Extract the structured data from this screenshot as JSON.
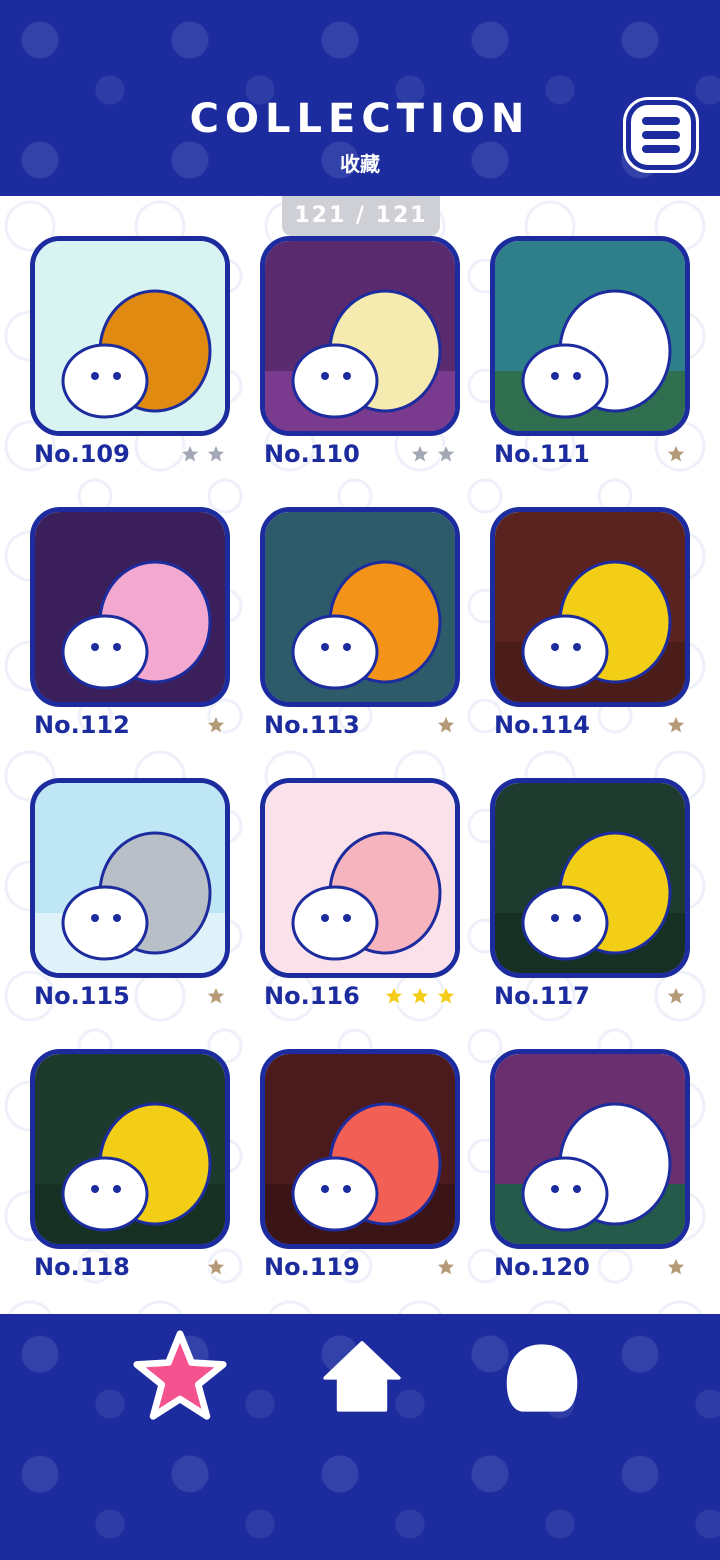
{
  "header": {
    "title": "COLLECTION",
    "subtitle": "收藏",
    "menu_icon": "menu-icon"
  },
  "counter": "121 / 121",
  "colors": {
    "navy": "#1c2c9e",
    "star_gold": "#f4cc1a",
    "star_gray": "#a3a9b4",
    "star_bronze": "#b59a77",
    "nav_star_pink": "#f4528f"
  },
  "cards": [
    {
      "number": "No.109",
      "stars": 2,
      "star_color": "gray"
    },
    {
      "number": "No.110",
      "stars": 2,
      "star_color": "gray"
    },
    {
      "number": "No.111",
      "stars": 1,
      "star_color": "bronze"
    },
    {
      "number": "No.112",
      "stars": 1,
      "star_color": "bronze"
    },
    {
      "number": "No.113",
      "stars": 1,
      "star_color": "bronze"
    },
    {
      "number": "No.114",
      "stars": 1,
      "star_color": "bronze"
    },
    {
      "number": "No.115",
      "stars": 1,
      "star_color": "bronze"
    },
    {
      "number": "No.116",
      "stars": 3,
      "star_color": "gold"
    },
    {
      "number": "No.117",
      "stars": 1,
      "star_color": "bronze"
    },
    {
      "number": "No.118",
      "stars": 1,
      "star_color": "bronze"
    },
    {
      "number": "No.119",
      "stars": 1,
      "star_color": "bronze"
    },
    {
      "number": "No.120",
      "stars": 1,
      "star_color": "bronze"
    }
  ],
  "bottom_nav": [
    {
      "icon": "star-icon",
      "active": true
    },
    {
      "icon": "home-icon",
      "active": false
    },
    {
      "icon": "character-icon",
      "active": false
    }
  ]
}
